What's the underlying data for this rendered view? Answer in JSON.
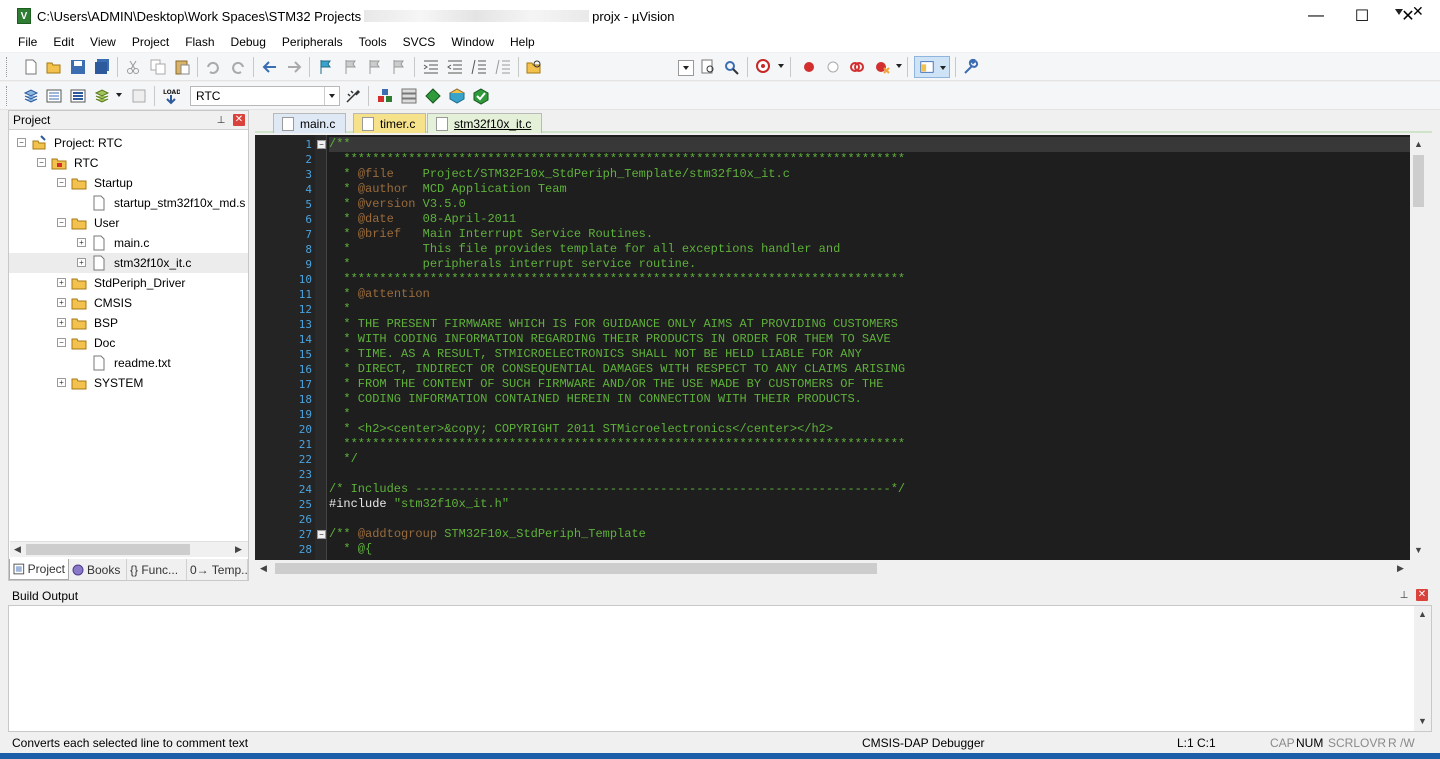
{
  "window": {
    "title_path": "C:\\Users\\ADMIN\\Desktop\\Work Spaces\\STM32 Projects",
    "title_app": "projx - µVision",
    "app_icon_letter": "V",
    "minimize": "—",
    "maximize": "☐",
    "close": "✕"
  },
  "menu": [
    "File",
    "Edit",
    "View",
    "Project",
    "Flash",
    "Debug",
    "Peripherals",
    "Tools",
    "SVCS",
    "Window",
    "Help"
  ],
  "toolbar": {
    "target": "RTC"
  },
  "project_panel": {
    "title": "Project",
    "pin": "📌",
    "close": "✕",
    "tree": [
      {
        "label": "Project: RTC"
      },
      {
        "label": "RTC"
      },
      {
        "label": "Startup"
      },
      {
        "label": "startup_stm32f10x_md.s"
      },
      {
        "label": "User"
      },
      {
        "label": "main.c"
      },
      {
        "label": "stm32f10x_it.c"
      },
      {
        "label": "StdPeriph_Driver"
      },
      {
        "label": "CMSIS"
      },
      {
        "label": "BSP"
      },
      {
        "label": "Doc"
      },
      {
        "label": "readme.txt"
      },
      {
        "label": "SYSTEM"
      }
    ],
    "tabs": [
      "Project",
      "Books",
      "{} Func...",
      "0→ Temp..."
    ]
  },
  "editor": {
    "tabs": [
      "main.c",
      "timer.c",
      "stm32f10x_it.c"
    ],
    "close": "✕",
    "line_numbers": [
      "1",
      "2",
      "3",
      "4",
      "5",
      "6",
      "7",
      "8",
      "9",
      "10",
      "11",
      "12",
      "13",
      "14",
      "15",
      "16",
      "17",
      "18",
      "19",
      "20",
      "21",
      "22",
      "23",
      "24",
      "25",
      "26",
      "27",
      "28"
    ],
    "lines": [
      "/**",
      "  ******************************************************************************",
      "  * @file    Project/STM32F10x_StdPeriph_Template/stm32f10x_it.c",
      "  * @author  MCD Application Team",
      "  * @version V3.5.0",
      "  * @date    08-April-2011",
      "  * @brief   Main Interrupt Service Routines.",
      "  *          This file provides template for all exceptions handler and",
      "  *          peripherals interrupt service routine.",
      "  ******************************************************************************",
      "  * @attention",
      "  *",
      "  * THE PRESENT FIRMWARE WHICH IS FOR GUIDANCE ONLY AIMS AT PROVIDING CUSTOMERS",
      "  * WITH CODING INFORMATION REGARDING THEIR PRODUCTS IN ORDER FOR THEM TO SAVE",
      "  * TIME. AS A RESULT, STMICROELECTRONICS SHALL NOT BE HELD LIABLE FOR ANY",
      "  * DIRECT, INDIRECT OR CONSEQUENTIAL DAMAGES WITH RESPECT TO ANY CLAIMS ARISING",
      "  * FROM THE CONTENT OF SUCH FIRMWARE AND/OR THE USE MADE BY CUSTOMERS OF THE",
      "  * CODING INFORMATION CONTAINED HEREIN IN CONNECTION WITH THEIR PRODUCTS.",
      "  *",
      "  * <h2><center>&copy; COPYRIGHT 2011 STMicroelectronics</center></h2>",
      "  ******************************************************************************",
      "  */",
      "",
      "/* Includes ------------------------------------------------------------------*/",
      "#include \"stm32f10x_it.h\"",
      "",
      "/** @addtogroup STM32F10x_StdPeriph_Template",
      "  * @{"
    ]
  },
  "build_output": {
    "title": "Build Output",
    "pin": "📌",
    "close": "✕"
  },
  "status": {
    "message": "Converts each selected line to comment text",
    "debugger": "CMSIS-DAP Debugger",
    "position": "L:1 C:1",
    "cap": "CAP",
    "num": "NUM",
    "scrl": "SCRL",
    "ovr": "OVR",
    "rw": "R /W"
  },
  "colors": {
    "editor_bg": "#1e1e1e",
    "comment": "#5fb13c",
    "doc_tag": "#9a6b3c",
    "line_number": "#4aa3df"
  }
}
